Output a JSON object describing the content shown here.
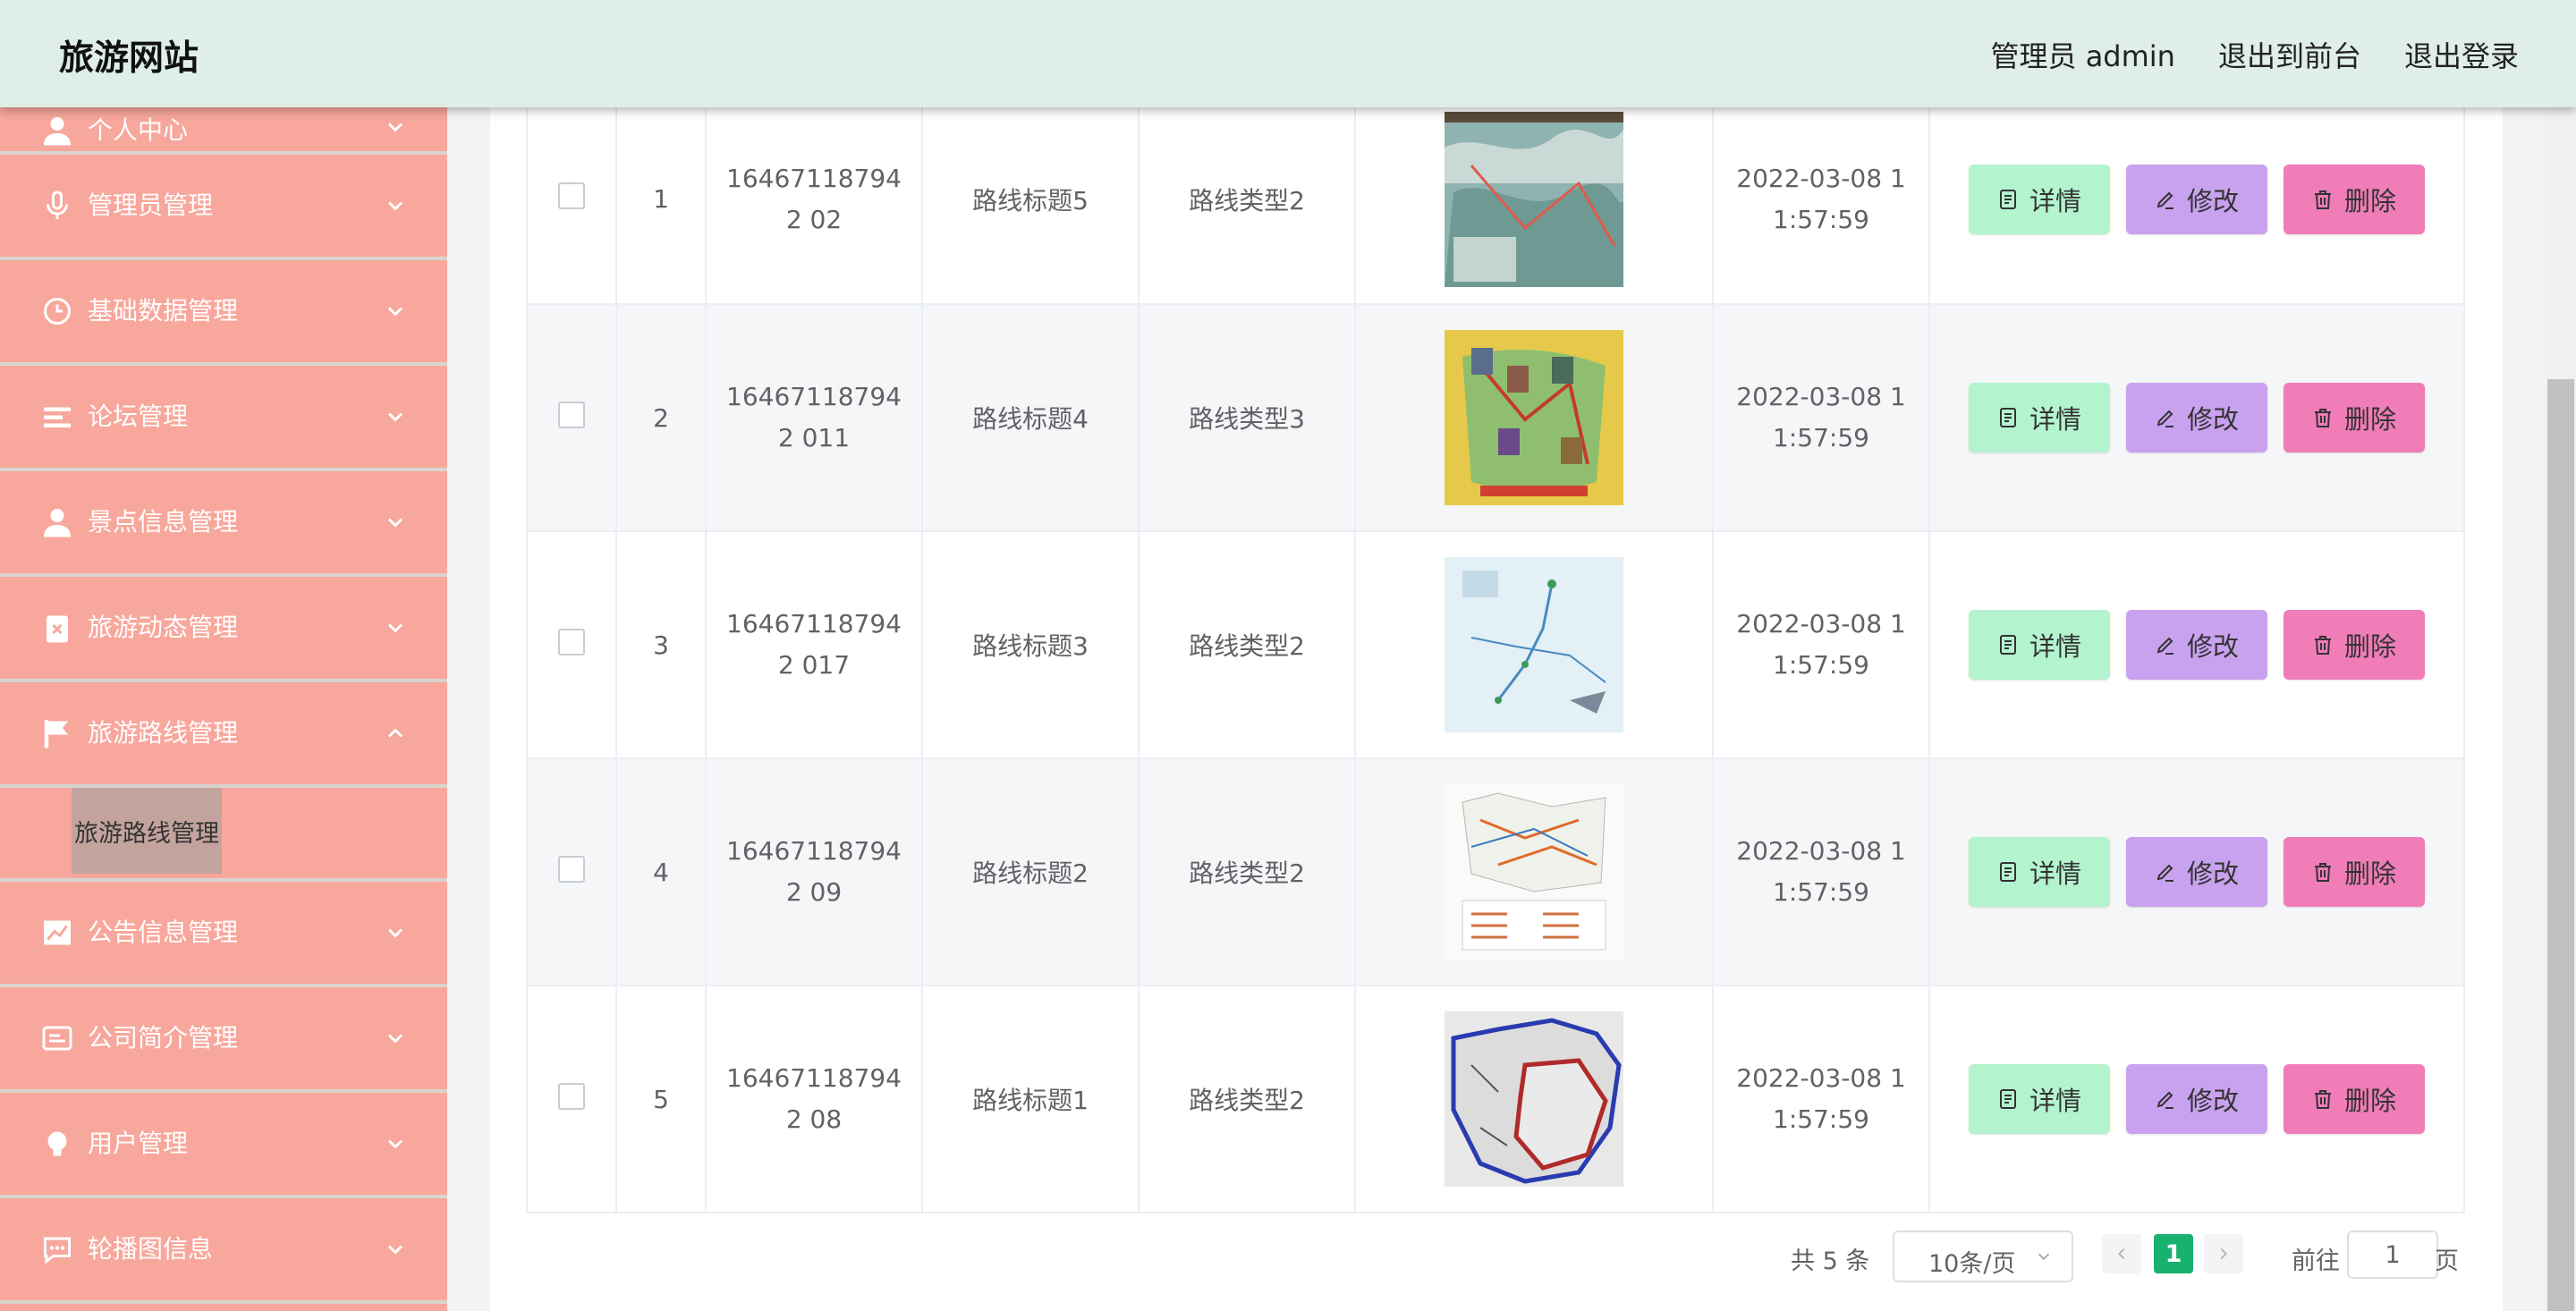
{
  "header": {
    "brand": "旅游网站",
    "nav": [
      "管理员 admin",
      "退出到前台",
      "退出登录"
    ]
  },
  "sidebar": {
    "items": [
      {
        "label": "个人中心",
        "icon": "user-icon"
      },
      {
        "label": "管理员管理",
        "icon": "microphone-icon"
      },
      {
        "label": "基础数据管理",
        "icon": "clock-icon"
      },
      {
        "label": "论坛管理",
        "icon": "list-icon"
      },
      {
        "label": "景点信息管理",
        "icon": "user-icon"
      },
      {
        "label": "旅游动态管理",
        "icon": "clipboard-icon"
      },
      {
        "label": "旅游路线管理",
        "icon": "flag-icon",
        "expanded": true
      },
      {
        "label": "公告信息管理",
        "icon": "chart-icon"
      },
      {
        "label": "公司简介管理",
        "icon": "card-icon"
      },
      {
        "label": "用户管理",
        "icon": "bulb-icon"
      },
      {
        "label": "轮播图信息",
        "icon": "chat-icon"
      }
    ],
    "active_sub": "旅游路线管理"
  },
  "table": {
    "rows": [
      {
        "index": "1",
        "id": "164671187942 02",
        "title": "路线标题5",
        "type": "路线类型2",
        "time": "2022-03-08 1 1:57:59",
        "thumb": "map-thumb-1"
      },
      {
        "index": "2",
        "id": "164671187942 011",
        "title": "路线标题4",
        "type": "路线类型3",
        "time": "2022-03-08 1 1:57:59",
        "thumb": "map-thumb-2"
      },
      {
        "index": "3",
        "id": "164671187942 017",
        "title": "路线标题3",
        "type": "路线类型2",
        "time": "2022-03-08 1 1:57:59",
        "thumb": "map-thumb-3"
      },
      {
        "index": "4",
        "id": "164671187942 09",
        "title": "路线标题2",
        "type": "路线类型2",
        "time": "2022-03-08 1 1:57:59",
        "thumb": "map-thumb-4"
      },
      {
        "index": "5",
        "id": "164671187942 08",
        "title": "路线标题1",
        "type": "路线类型2",
        "time": "2022-03-08 1 1:57:59",
        "thumb": "map-thumb-5"
      }
    ],
    "actions": {
      "detail": "详情",
      "edit": "修改",
      "delete": "删除"
    }
  },
  "pagination": {
    "total": "共 5 条",
    "page_size": "10条/页",
    "current_page": "1",
    "goto_label": "前往",
    "goto_value": "1",
    "page_suffix": "页"
  },
  "colors": {
    "header_bg": "#dfeee6",
    "sidebar_bg": "#f8a79c",
    "detail_btn": "#b3f4cf",
    "edit_btn": "#c9a2ef",
    "delete_btn": "#f07cb8",
    "active_page": "#18b26e"
  }
}
